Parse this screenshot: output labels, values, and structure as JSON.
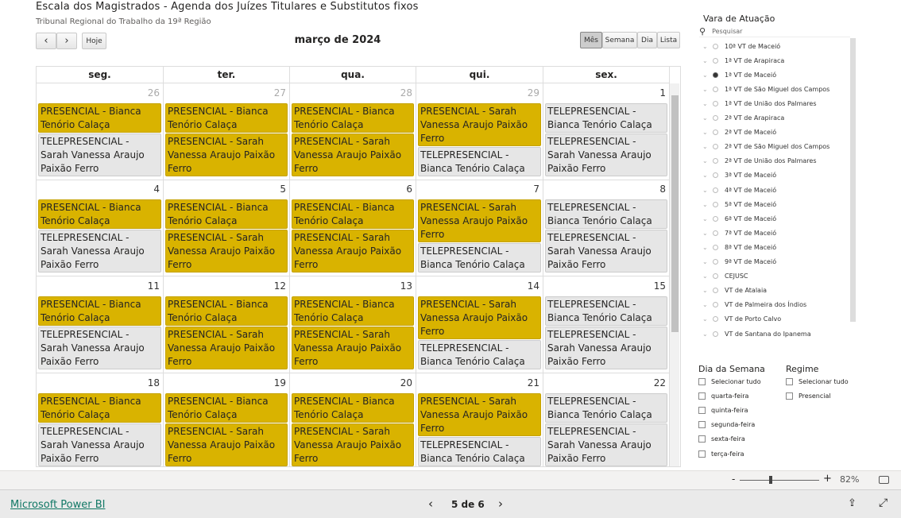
{
  "header": {
    "title": "Escala dos Magistrados - Agenda dos Juízes Titulares e Substitutos fixos",
    "subtitle": "Tribunal Regional do Trabalho da 19ª Região"
  },
  "toolbar": {
    "prev": "‹",
    "next": "›",
    "today": "Hoje",
    "month_title": "março de 2024",
    "views": [
      "Mês",
      "Semana",
      "Dia",
      "Lista"
    ],
    "active_view": "Mês"
  },
  "calendar": {
    "weekdays": [
      "seg.",
      "ter.",
      "qua.",
      "qui.",
      "sex."
    ],
    "weeks": [
      {
        "days": [
          {
            "n": "26",
            "cur": false
          },
          {
            "n": "27",
            "cur": false
          },
          {
            "n": "28",
            "cur": false
          },
          {
            "n": "29",
            "cur": false
          },
          {
            "n": "1",
            "cur": true
          }
        ]
      },
      {
        "days": [
          {
            "n": "4",
            "cur": true
          },
          {
            "n": "5",
            "cur": true
          },
          {
            "n": "6",
            "cur": true
          },
          {
            "n": "7",
            "cur": true
          },
          {
            "n": "8",
            "cur": true
          }
        ]
      },
      {
        "days": [
          {
            "n": "11",
            "cur": true
          },
          {
            "n": "12",
            "cur": true
          },
          {
            "n": "13",
            "cur": true
          },
          {
            "n": "14",
            "cur": true
          },
          {
            "n": "15",
            "cur": true
          }
        ]
      },
      {
        "days": [
          {
            "n": "18",
            "cur": true
          },
          {
            "n": "19",
            "cur": true
          },
          {
            "n": "20",
            "cur": true
          },
          {
            "n": "21",
            "cur": true
          },
          {
            "n": "22",
            "cur": true
          }
        ]
      }
    ],
    "weekday_events": [
      [
        {
          "type": "p",
          "text": "PRESENCIAL - Bianca Tenório Calaça"
        },
        {
          "type": "t",
          "text": "TELEPRESENCIAL - Sarah Vanessa Araujo Paixão Ferro"
        }
      ],
      [
        {
          "type": "p",
          "text": "PRESENCIAL - Bianca Tenório Calaça"
        },
        {
          "type": "p",
          "text": "PRESENCIAL - Sarah Vanessa Araujo Paixão Ferro"
        }
      ],
      [
        {
          "type": "p",
          "text": "PRESENCIAL - Bianca Tenório Calaça"
        },
        {
          "type": "p",
          "text": "PRESENCIAL - Sarah Vanessa Araujo Paixão Ferro"
        }
      ],
      [
        {
          "type": "p",
          "text": "PRESENCIAL - Sarah Vanessa Araujo Paixão Ferro"
        },
        {
          "type": "t",
          "text": "TELEPRESENCIAL - Bianca Tenório Calaça"
        }
      ],
      [
        {
          "type": "t",
          "text": "TELEPRESENCIAL - Bianca Tenório Calaça"
        },
        {
          "type": "t",
          "text": "TELEPRESENCIAL - Sarah Vanessa Araujo Paixão Ferro"
        }
      ]
    ],
    "colors": {
      "presencial": "#d9b300",
      "telepresencial": "#e6e6e6"
    }
  },
  "vara": {
    "title": "Vara de Atuação",
    "search_placeholder": "Pesquisar",
    "selected": "1ª VT de Maceió",
    "items": [
      "10ª VT de Maceió",
      "1ª VT de Arapiraca",
      "1ª VT de Maceió",
      "1ª VT de São Miguel dos Campos",
      "1ª VT de União dos Palmares",
      "2ª VT de Arapiraca",
      "2ª VT de Maceió",
      "2ª VT de São Miguel dos Campos",
      "2ª VT de União dos Palmares",
      "3ª VT de Maceió",
      "4ª VT de Maceió",
      "5ª VT de Maceió",
      "6ª VT de Maceió",
      "7ª VT de Maceió",
      "8ª VT de Maceió",
      "9ª VT de Maceió",
      "CEJUSC",
      "VT de Atalaia",
      "VT de Palmeira dos Índios",
      "VT de Porto Calvo",
      "VT de Santana do Ipanema"
    ]
  },
  "dia_semana": {
    "title": "Dia da Semana",
    "items": [
      "Selecionar tudo",
      "quarta-feira",
      "quinta-feira",
      "segunda-feira",
      "sexta-feira",
      "terça-feira"
    ]
  },
  "regime": {
    "title": "Regime",
    "items": [
      "Selecionar tudo",
      "Presencial"
    ]
  },
  "zoom": {
    "minus": "-",
    "plus": "+",
    "level": "82%",
    "value_percent": 82
  },
  "footer": {
    "brand": "Microsoft Power BI",
    "page": "5 de 6"
  }
}
